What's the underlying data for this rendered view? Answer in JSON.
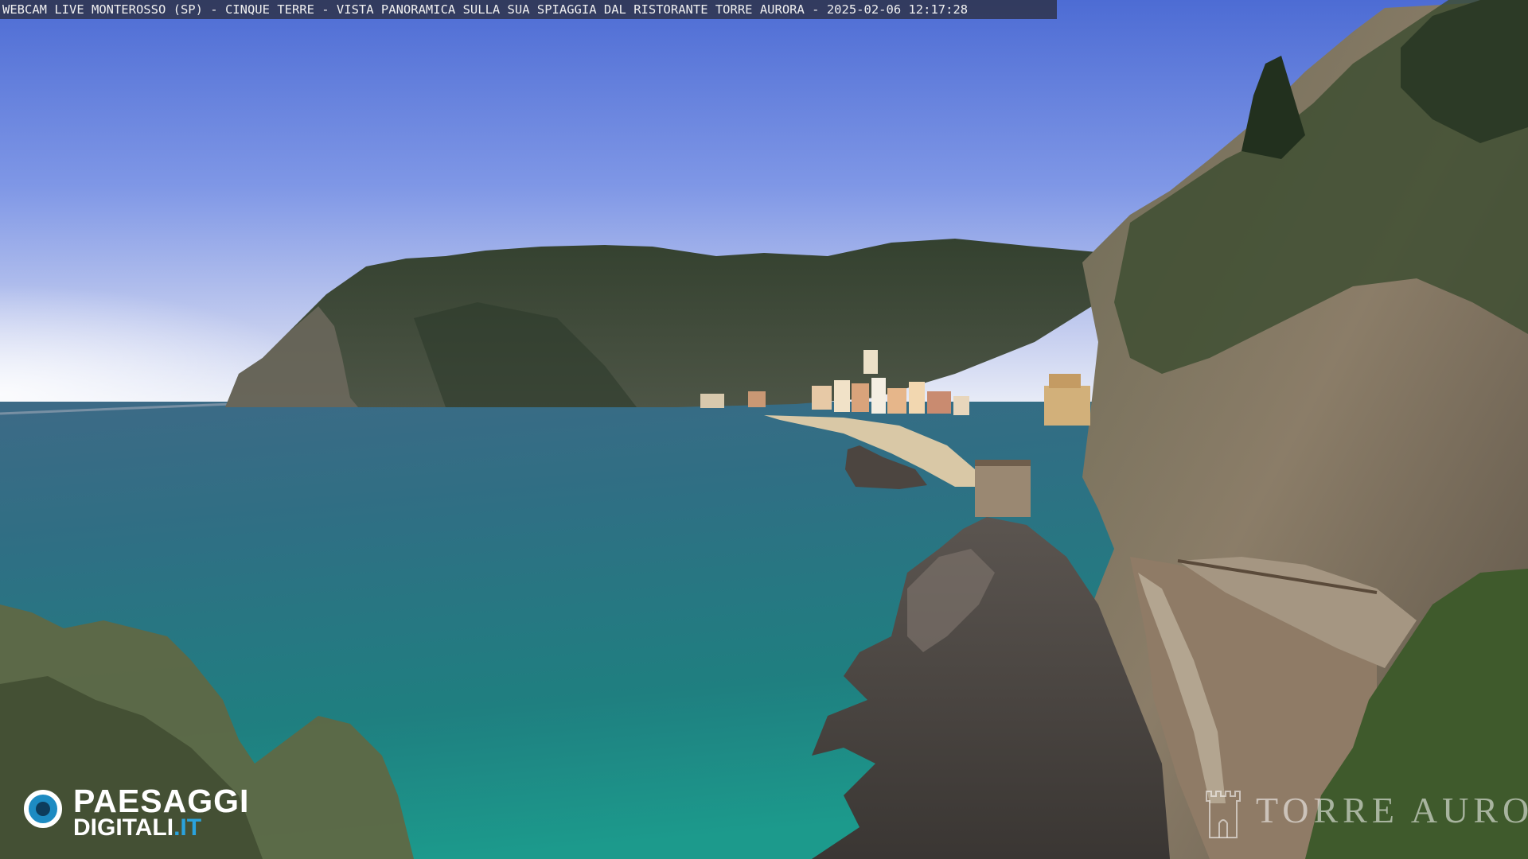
{
  "caption": {
    "text": "WEBCAM LIVE MONTEROSSO (SP) - CINQUE TERRE - VISTA PANORAMICA SULLA SUA SPIAGGIA DAL RISTORANTE TORRE AURORA - 2025-02-06 12:17:28"
  },
  "logo": {
    "line1": "PAESAGGI",
    "line2": "DIGITALI",
    "tld": ".IT"
  },
  "watermark": {
    "text": "TORRE AURORA"
  },
  "colors": {
    "sky_top": "#4f6fd6",
    "sky_horizon": "#e9ecf6",
    "sea_far": "#3d6d88",
    "sea_near": "#1f8d86",
    "hill": "#3d4a36",
    "cliff": "#8a7a66",
    "logo_blue": "#2aa3dd"
  }
}
